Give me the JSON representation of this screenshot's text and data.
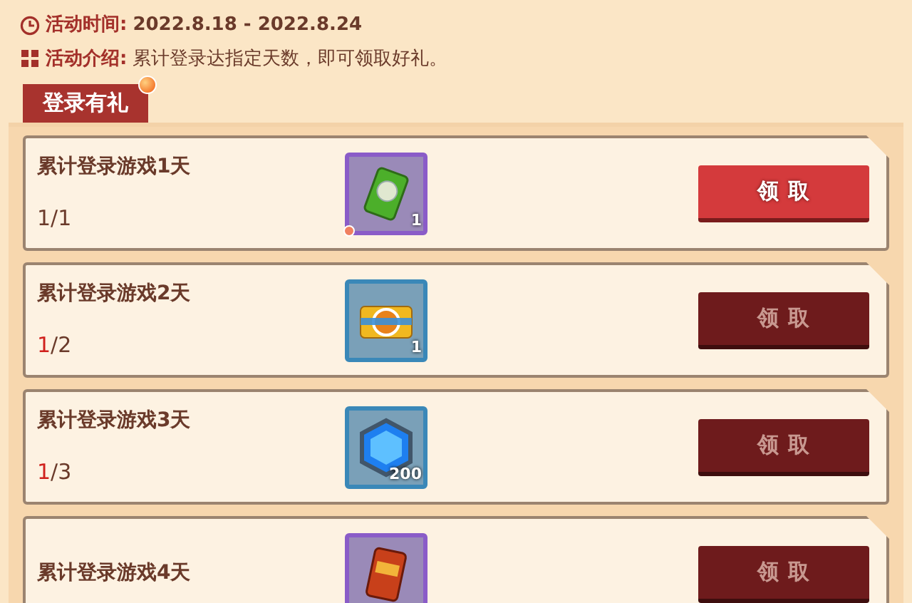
{
  "event_time": {
    "label": "活动时间:",
    "value": "2022.8.18 - 2022.8.24"
  },
  "event_intro": {
    "label": "活动介绍:",
    "value": "累计登录达指定天数，即可领取好礼。"
  },
  "tab": {
    "label": "登录有礼",
    "badge": true
  },
  "rows": [
    {
      "title": "累计登录游戏1天",
      "progress_count": "1",
      "progress_goal": "/1",
      "claimable": true,
      "item": {
        "kind": "card",
        "quantity": "1",
        "badge": true
      },
      "button": "领 取"
    },
    {
      "title": "累计登录游戏2天",
      "progress_count": "1",
      "progress_goal": "/2",
      "claimable": false,
      "item": {
        "kind": "ticket",
        "quantity": "1",
        "badge": false
      },
      "button": "领 取"
    },
    {
      "title": "累计登录游戏3天",
      "progress_count": "1",
      "progress_goal": "/3",
      "claimable": false,
      "item": {
        "kind": "gem",
        "quantity": "200",
        "badge": false
      },
      "button": "领 取"
    },
    {
      "title": "累计登录游戏4天",
      "claimable": false,
      "item": {
        "kind": "pack"
      },
      "button": "领 取"
    }
  ]
}
